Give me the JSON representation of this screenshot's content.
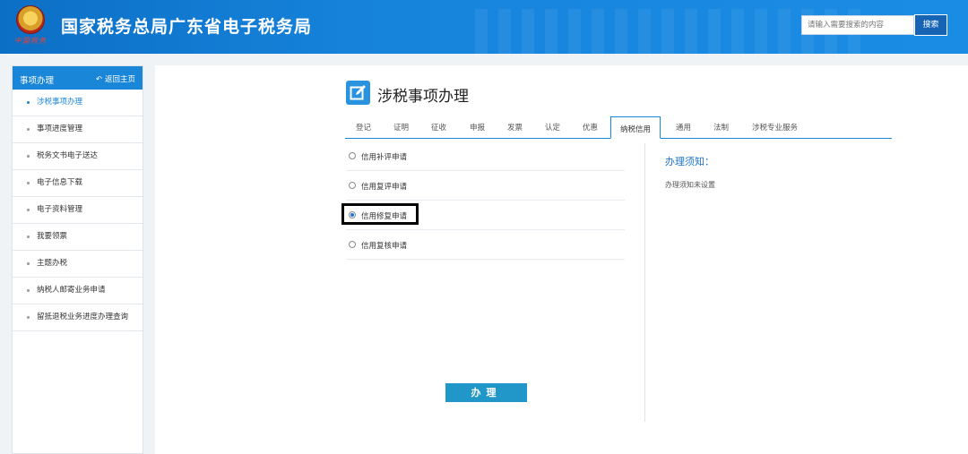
{
  "header": {
    "emblem_script": "中国税务",
    "title": "国家税务总局广东省电子税务局",
    "search": {
      "placeholder": "请输入需要搜索的内容",
      "button_label": "搜索"
    }
  },
  "sidebar": {
    "title": "事项办理",
    "back_label": "返回主页",
    "back_icon": "reply-arrow-icon",
    "items": [
      {
        "label": "涉税事项办理",
        "active": true
      },
      {
        "label": "事项进度管理"
      },
      {
        "label": "税务文书电子送达"
      },
      {
        "label": "电子信息下载"
      },
      {
        "label": "电子资料管理"
      },
      {
        "label": "我要领票"
      },
      {
        "label": "主题办税"
      },
      {
        "label": "纳税人邮寄业务申请"
      },
      {
        "label": "留抵退税业务进度办理查询"
      }
    ]
  },
  "main": {
    "page_icon": "edit-icon",
    "title": "涉税事项办理",
    "tabs": [
      {
        "label": "登记"
      },
      {
        "label": "证明"
      },
      {
        "label": "征收"
      },
      {
        "label": "申报"
      },
      {
        "label": "发票"
      },
      {
        "label": "认定"
      },
      {
        "label": "优惠"
      },
      {
        "label": "纳税信用",
        "active": true
      },
      {
        "label": "通用"
      },
      {
        "label": "法制"
      },
      {
        "label": "涉税专业服务"
      }
    ],
    "options": [
      {
        "label": "信用补评申请",
        "checked": false
      },
      {
        "label": "信用复评申请",
        "checked": false
      },
      {
        "label": "信用修复申请",
        "checked": true
      },
      {
        "label": "信用复核申请",
        "checked": false
      }
    ],
    "notice": {
      "title": "办理须知：",
      "text": "办理须知未设置"
    },
    "action_label": "办理"
  },
  "colors": {
    "header_blue": "#1784dc",
    "accent": "#1a86d8",
    "button": "#2196c9"
  }
}
